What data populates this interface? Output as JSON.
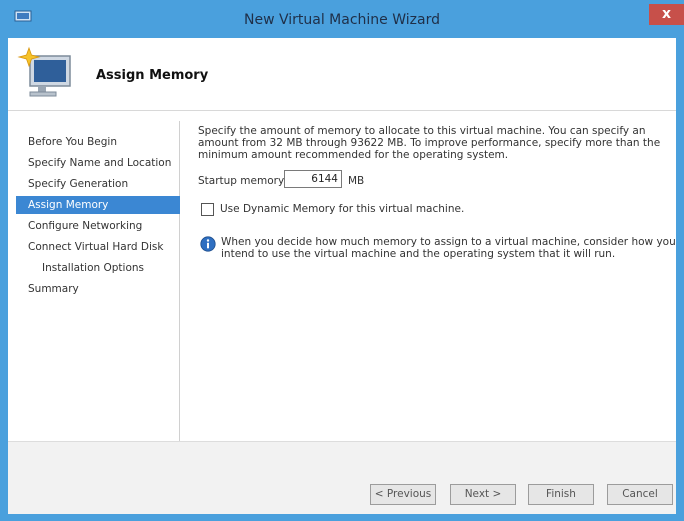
{
  "window": {
    "title": "New Virtual Machine Wizard",
    "close_label": "x"
  },
  "header": {
    "title": "Assign Memory"
  },
  "nav": {
    "items": [
      {
        "label": "Before You Begin"
      },
      {
        "label": "Specify Name and Location"
      },
      {
        "label": "Specify Generation"
      },
      {
        "label": "Assign Memory",
        "selected": true
      },
      {
        "label": "Configure Networking"
      },
      {
        "label": "Connect Virtual Hard Disk"
      },
      {
        "label": "Installation Options",
        "sub": true
      },
      {
        "label": "Summary"
      }
    ]
  },
  "content": {
    "description": "Specify the amount of memory to allocate to this virtual machine. You can specify an amount from 32 MB through 93622 MB. To improve performance, specify more than the minimum amount recommended for the operating system.",
    "startup_memory_label": "Startup memory:",
    "startup_memory_value": "6144",
    "startup_memory_unit": "MB",
    "dynamic_memory_label": "Use Dynamic Memory for this virtual machine.",
    "dynamic_memory_checked": false,
    "info_text": "When you decide how much memory to assign to a virtual machine, consider how you intend to use the virtual machine and the operating system that it will run."
  },
  "buttons": {
    "previous": "< Previous",
    "next": "Next >",
    "finish": "Finish",
    "cancel": "Cancel"
  },
  "colors": {
    "titlebar": "#4aa0dd",
    "selected_nav": "#3b87d3",
    "close_button": "#c7504a"
  }
}
